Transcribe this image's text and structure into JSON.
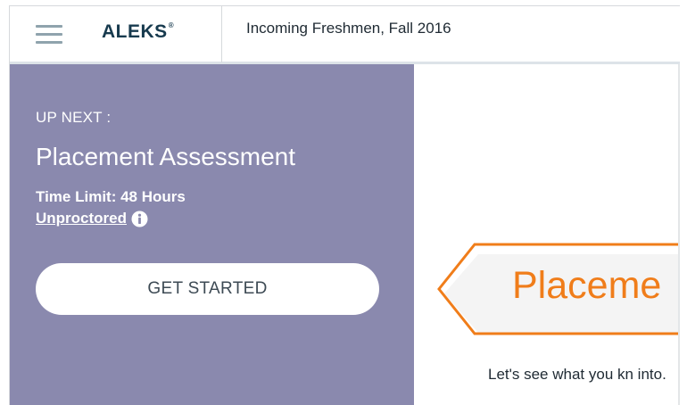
{
  "header": {
    "menu_icon": "hamburger-menu-icon",
    "logo_text": "ALEKS",
    "logo_mark": "®",
    "course_title": "Incoming Freshmen, Fall 2016"
  },
  "left_panel": {
    "up_next_label": "UP NEXT :",
    "assessment_title": "Placement Assessment",
    "time_limit": "Time Limit: 48 Hours",
    "proctor_status": "Unproctored",
    "info_icon": "info-icon",
    "button_label": "GET STARTED"
  },
  "right_panel": {
    "banner_text": "Placeme",
    "intro_text": "Let's see what you kn into."
  },
  "colors": {
    "panel_bg": "#8a89ae",
    "accent_orange": "#f07d1a",
    "logo_navy": "#173a4e"
  }
}
